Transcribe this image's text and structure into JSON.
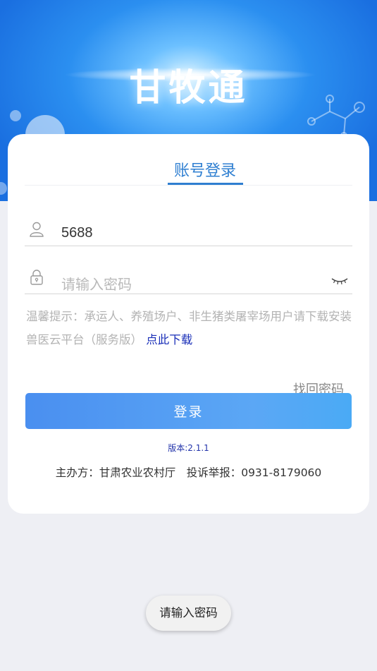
{
  "header": {
    "app_title": "甘牧通"
  },
  "tabs": [
    {
      "label": "账号登录",
      "active": true
    }
  ],
  "form": {
    "username": {
      "value": "5688"
    },
    "password": {
      "value": "",
      "placeholder": "请输入密码"
    }
  },
  "tip": {
    "text": "温馨提示：承运人、养殖场户、非生猪类屠宰场用户请下载安装兽医云平台（服务版）",
    "link_label": "点此下载"
  },
  "actions": {
    "forgot_label": "找回密码",
    "login_label": "登录"
  },
  "version": "版本:2.1.1",
  "footer": {
    "text": "主办方：甘肃农业农村厅　投诉举报：0931-8179060"
  },
  "toast": {
    "text": "请输入密码"
  },
  "colors": {
    "accent": "#2f7fd1",
    "link": "#1a2fb8",
    "button_start": "#4a8ff0",
    "button_end": "#4aaaf5"
  },
  "icons": [
    "user-icon",
    "lock-icon",
    "eye-closed-icon"
  ]
}
